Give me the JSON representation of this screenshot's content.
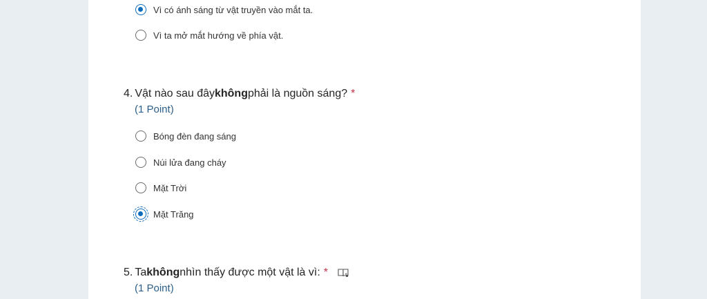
{
  "q3": {
    "options": [
      {
        "label": "Vì có ánh sáng từ vật truyền vào mắt ta.",
        "selected": true
      },
      {
        "label": "Vì ta mở mắt hướng về phía vật.",
        "selected": false
      }
    ]
  },
  "q4": {
    "number": "4.",
    "title_before": "Vật nào sau đây ",
    "title_bold": "không",
    "title_after": " phải là nguồn sáng?",
    "required_mark": "*",
    "points": "(1 Point)",
    "options": [
      {
        "label": "Bóng đèn đang sáng",
        "selected": false
      },
      {
        "label": "Núi lửa đang cháy",
        "selected": false
      },
      {
        "label": "Mặt Trời",
        "selected": false
      },
      {
        "label": "Mặt Trăng",
        "selected": true
      }
    ]
  },
  "q5": {
    "number": "5.",
    "title_before": "Ta ",
    "title_bold": "không",
    "title_after": " nhìn thấy được một vật là vì:",
    "required_mark": "*",
    "points": "(1 Point)",
    "icon": "immersive-reader-icon"
  },
  "colors": {
    "accent": "#0f6cbd",
    "required": "#c4314b",
    "points": "#2b5f8a",
    "background": "#e9eef2"
  }
}
